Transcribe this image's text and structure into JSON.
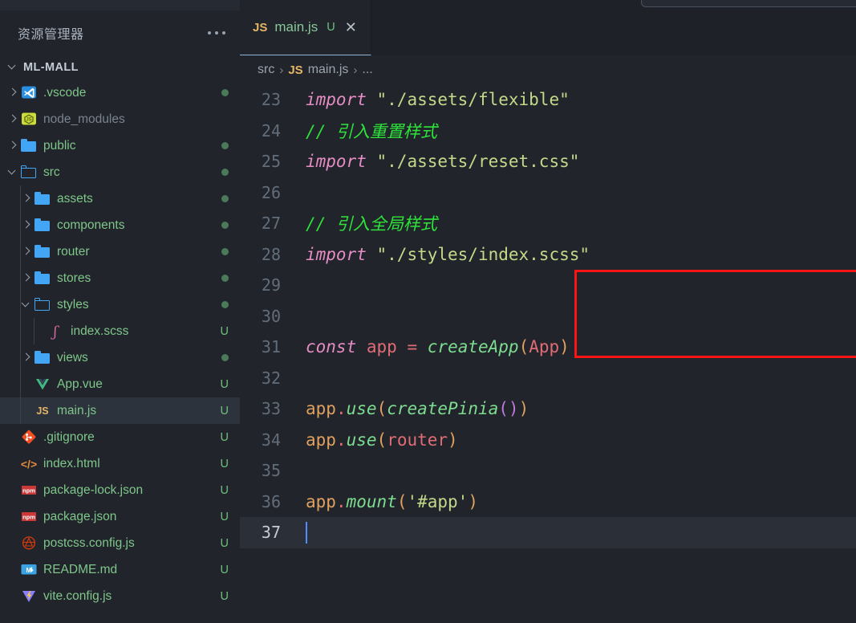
{
  "window": {
    "theme_bg": "#21252b",
    "accent": "#42a5f5",
    "highlight_box_color": "#fb1414"
  },
  "sidebar": {
    "header": {
      "title": "资源管理器",
      "more_actions": "..."
    },
    "root": {
      "label": "ML-MALL",
      "expanded": true
    },
    "items": [
      {
        "label": ".vscode",
        "icon": "vscode-folder-icon",
        "depth": 1,
        "kind": "folder",
        "arrow": "collapsed",
        "status": "modified-dot",
        "dim": false
      },
      {
        "label": "node_modules",
        "icon": "nodejs-folder-icon",
        "depth": 1,
        "kind": "folder",
        "arrow": "collapsed",
        "status": "",
        "dim": true
      },
      {
        "label": "public",
        "icon": "folder-icon",
        "depth": 1,
        "kind": "folder",
        "arrow": "collapsed",
        "status": "modified-dot",
        "dim": false
      },
      {
        "label": "src",
        "icon": "folder-open-icon",
        "depth": 1,
        "kind": "folder",
        "arrow": "expanded",
        "status": "modified-dot",
        "dim": false
      },
      {
        "label": "assets",
        "icon": "folder-icon",
        "depth": 2,
        "kind": "folder",
        "arrow": "collapsed",
        "status": "modified-dot",
        "dim": false
      },
      {
        "label": "components",
        "icon": "folder-icon",
        "depth": 2,
        "kind": "folder",
        "arrow": "collapsed",
        "status": "modified-dot",
        "dim": false
      },
      {
        "label": "router",
        "icon": "folder-icon",
        "depth": 2,
        "kind": "folder",
        "arrow": "collapsed",
        "status": "modified-dot",
        "dim": false
      },
      {
        "label": "stores",
        "icon": "folder-icon",
        "depth": 2,
        "kind": "folder",
        "arrow": "collapsed",
        "status": "modified-dot",
        "dim": false
      },
      {
        "label": "styles",
        "icon": "folder-open-icon",
        "depth": 2,
        "kind": "folder",
        "arrow": "expanded",
        "status": "modified-dot",
        "dim": false
      },
      {
        "label": "index.scss",
        "icon": "sass-icon",
        "depth": 3,
        "kind": "file",
        "arrow": "none",
        "status": "U",
        "dim": false
      },
      {
        "label": "views",
        "icon": "folder-icon",
        "depth": 2,
        "kind": "folder",
        "arrow": "collapsed",
        "status": "modified-dot",
        "dim": false
      },
      {
        "label": "App.vue",
        "icon": "vue-icon",
        "depth": 2,
        "kind": "file",
        "arrow": "none",
        "status": "U",
        "dim": false
      },
      {
        "label": "main.js",
        "icon": "js-icon",
        "depth": 2,
        "kind": "file",
        "arrow": "none",
        "status": "U",
        "dim": false,
        "selected": true
      },
      {
        "label": ".gitignore",
        "icon": "git-icon",
        "depth": 1,
        "kind": "file",
        "arrow": "none",
        "status": "U",
        "dim": false
      },
      {
        "label": "index.html",
        "icon": "html-icon",
        "depth": 1,
        "kind": "file",
        "arrow": "none",
        "status": "U",
        "dim": false
      },
      {
        "label": "package-lock.json",
        "icon": "npm-icon",
        "depth": 1,
        "kind": "file",
        "arrow": "none",
        "status": "U",
        "dim": false
      },
      {
        "label": "package.json",
        "icon": "npm-icon",
        "depth": 1,
        "kind": "file",
        "arrow": "none",
        "status": "U",
        "dim": false
      },
      {
        "label": "postcss.config.js",
        "icon": "postcss-icon",
        "depth": 1,
        "kind": "file",
        "arrow": "none",
        "status": "U",
        "dim": false
      },
      {
        "label": "README.md",
        "icon": "markdown-icon",
        "depth": 1,
        "kind": "file",
        "arrow": "none",
        "status": "U",
        "dim": false
      },
      {
        "label": "vite.config.js",
        "icon": "vite-icon",
        "depth": 1,
        "kind": "file",
        "arrow": "none",
        "status": "U",
        "dim": false
      }
    ]
  },
  "editor": {
    "tab": {
      "icon_label": "JS",
      "filename": "main.js",
      "status": "U",
      "close": "✕"
    },
    "breadcrumb": {
      "root": "src",
      "sep": "›",
      "file_icon_label": "JS",
      "file": "main.js",
      "tail": "..."
    },
    "cursor_line": 37,
    "lines": [
      {
        "n": "23",
        "tokens": [
          {
            "t": "import",
            "c": "t-kw"
          },
          {
            "t": " ",
            "c": ""
          },
          {
            "t": "\"./assets/flexible\"",
            "c": "t-str"
          }
        ]
      },
      {
        "n": "24",
        "tokens": [
          {
            "t": "// 引入重置样式",
            "c": "t-cmt"
          }
        ]
      },
      {
        "n": "25",
        "tokens": [
          {
            "t": "import",
            "c": "t-kw"
          },
          {
            "t": " ",
            "c": ""
          },
          {
            "t": "\"./assets/reset.css\"",
            "c": "t-str"
          }
        ]
      },
      {
        "n": "26",
        "tokens": []
      },
      {
        "n": "27",
        "tokens": [
          {
            "t": "// 引入全局样式",
            "c": "t-cmt"
          }
        ]
      },
      {
        "n": "28",
        "tokens": [
          {
            "t": "import",
            "c": "t-kw"
          },
          {
            "t": " ",
            "c": ""
          },
          {
            "t": "\"./styles/index.scss\"",
            "c": "t-str"
          }
        ]
      },
      {
        "n": "29",
        "tokens": []
      },
      {
        "n": "30",
        "tokens": []
      },
      {
        "n": "31",
        "tokens": [
          {
            "t": "const",
            "c": "t-kw"
          },
          {
            "t": " ",
            "c": ""
          },
          {
            "t": "app",
            "c": "t-id"
          },
          {
            "t": " ",
            "c": ""
          },
          {
            "t": "=",
            "c": "t-op"
          },
          {
            "t": " ",
            "c": ""
          },
          {
            "t": "createApp",
            "c": "t-fn"
          },
          {
            "t": "(",
            "c": "t-b1"
          },
          {
            "t": "App",
            "c": "t-id"
          },
          {
            "t": ")",
            "c": "t-b1"
          }
        ]
      },
      {
        "n": "32",
        "tokens": []
      },
      {
        "n": "33",
        "tokens": [
          {
            "t": "app",
            "c": "t-var"
          },
          {
            "t": ".",
            "c": "t-dot"
          },
          {
            "t": "use",
            "c": "t-fn"
          },
          {
            "t": "(",
            "c": "t-b1"
          },
          {
            "t": "createPinia",
            "c": "t-fn"
          },
          {
            "t": "(",
            "c": "t-b2"
          },
          {
            "t": ")",
            "c": "t-b2"
          },
          {
            "t": ")",
            "c": "t-b1"
          }
        ]
      },
      {
        "n": "34",
        "tokens": [
          {
            "t": "app",
            "c": "t-var"
          },
          {
            "t": ".",
            "c": "t-dot"
          },
          {
            "t": "use",
            "c": "t-fn"
          },
          {
            "t": "(",
            "c": "t-b1"
          },
          {
            "t": "router",
            "c": "t-id"
          },
          {
            "t": ")",
            "c": "t-b1"
          }
        ]
      },
      {
        "n": "35",
        "tokens": []
      },
      {
        "n": "36",
        "tokens": [
          {
            "t": "app",
            "c": "t-var"
          },
          {
            "t": ".",
            "c": "t-dot"
          },
          {
            "t": "mount",
            "c": "t-fn"
          },
          {
            "t": "(",
            "c": "t-b1"
          },
          {
            "t": "'#app'",
            "c": "t-str"
          },
          {
            "t": ")",
            "c": "t-b1"
          }
        ]
      },
      {
        "n": "37",
        "tokens": [],
        "active": true
      }
    ],
    "annotation": {
      "shape": "rectangle",
      "color": "#fb1414",
      "covers_lines": [
        "27",
        "28"
      ]
    }
  }
}
